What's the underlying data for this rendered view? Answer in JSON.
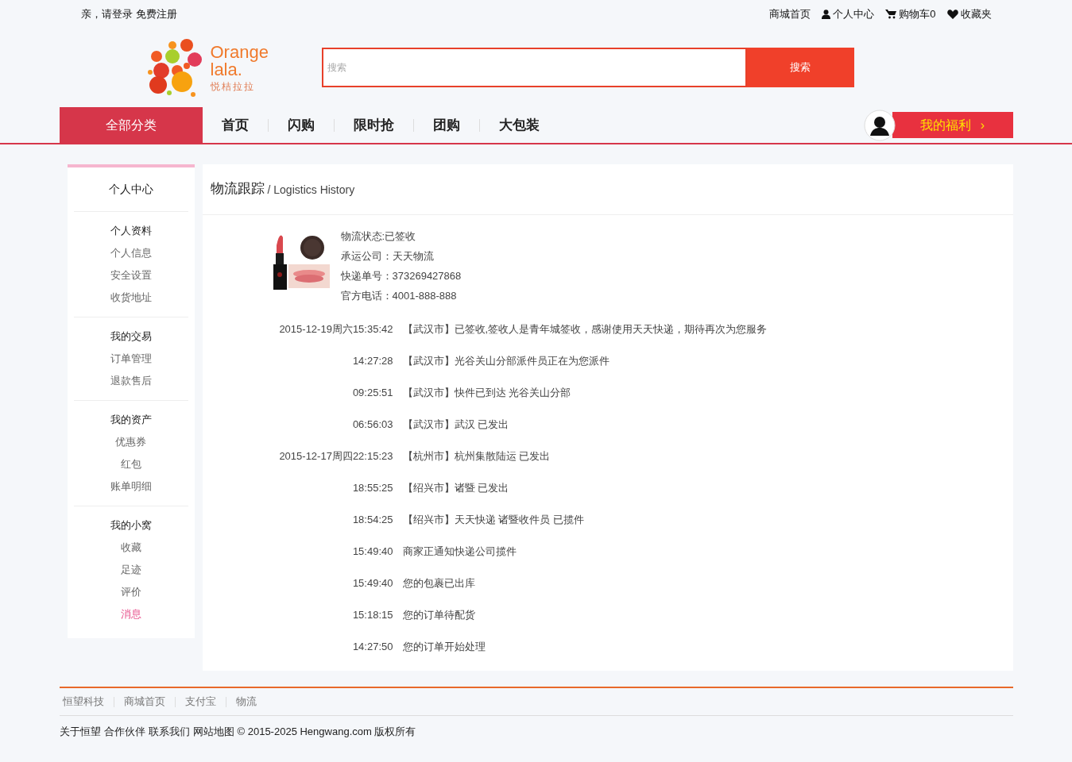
{
  "top_bar": {
    "greeting": "亲，请登录",
    "register": "免费注册",
    "links": [
      {
        "kind": "text",
        "label": "商城首页"
      },
      {
        "kind": "user",
        "label": "个人中心"
      },
      {
        "kind": "cart",
        "label": "购物车0"
      },
      {
        "kind": "heart",
        "label": "收藏夹"
      }
    ]
  },
  "logo": {
    "name_line1": "Orange",
    "name_line2": "lala.",
    "tagline": "悦桔拉拉"
  },
  "search": {
    "placeholder": "搜索",
    "button": "搜索"
  },
  "nav": {
    "all_categories": "全部分类",
    "items": [
      "首页",
      "闪购",
      "限时抢",
      "团购",
      "大包装"
    ],
    "welfare": "我的福利",
    "welfare_arrow": "›"
  },
  "sidebar": {
    "title": "个人中心",
    "groups": [
      {
        "heading": "个人资料",
        "items": [
          {
            "label": "个人信息",
            "selected": false
          },
          {
            "label": "安全设置",
            "selected": false
          },
          {
            "label": "收货地址",
            "selected": false
          }
        ]
      },
      {
        "heading": "我的交易",
        "items": [
          {
            "label": "订单管理",
            "selected": false
          },
          {
            "label": "退款售后",
            "selected": false
          }
        ]
      },
      {
        "heading": "我的资产",
        "items": [
          {
            "label": "优惠券",
            "selected": false
          },
          {
            "label": "红包",
            "selected": false
          },
          {
            "label": "账单明细",
            "selected": false
          }
        ]
      },
      {
        "heading": "我的小窝",
        "items": [
          {
            "label": "收藏",
            "selected": false
          },
          {
            "label": "足迹",
            "selected": false
          },
          {
            "label": "评价",
            "selected": false
          },
          {
            "label": "消息",
            "selected": true
          }
        ]
      }
    ]
  },
  "main": {
    "title": "物流跟踪",
    "subtitle": "/ Logistics History",
    "product": {
      "kind": "picture"
    },
    "info": [
      "物流状态:已签收",
      "承运公司：天天物流",
      "快递单号：373269427868",
      "官方电话：4001-888-888"
    ],
    "history": [
      {
        "time": "2015-12-19周六15:35:42",
        "text": "【武汉市】已签收,签收人是青年城签收，感谢使用天天快递，期待再次为您服务"
      },
      {
        "time": "14:27:28",
        "text": "【武汉市】光谷关山分部派件员正在为您派件"
      },
      {
        "time": "09:25:51",
        "text": "【武汉市】快件已到达 光谷关山分部"
      },
      {
        "time": "06:56:03",
        "text": "【武汉市】武汉 已发出"
      },
      {
        "time": "2015-12-17周四22:15:23",
        "text": "【杭州市】杭州集散陆运 已发出"
      },
      {
        "time": "18:55:25",
        "text": "【绍兴市】诸暨 已发出"
      },
      {
        "time": "18:54:25",
        "text": "【绍兴市】天天快递 诸暨收件员 已揽件"
      },
      {
        "time": "15:49:40",
        "text": "商家正通知快递公司揽件"
      },
      {
        "time": "15:49:40",
        "text": "您的包裹已出库"
      },
      {
        "time": "15:18:15",
        "text": "您的订单待配货"
      },
      {
        "time": "14:27:50",
        "text": "您的订单开始处理"
      }
    ]
  },
  "footer": {
    "links": [
      "恒望科技",
      "商城首页",
      "支付宝",
      "物流"
    ],
    "bottom_links": [
      "关于恒望",
      "合作伙伴",
      "联系我们",
      "网站地图"
    ],
    "copyright": "© 2015-2025 Hengwang.com 版权所有"
  }
}
